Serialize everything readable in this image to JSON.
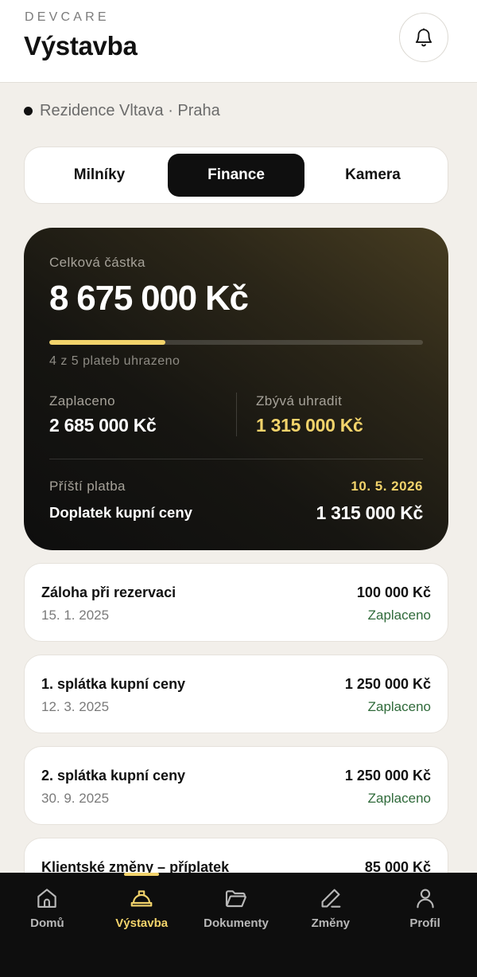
{
  "header": {
    "brand": "DEVCARE",
    "title": "Výstavba",
    "notification_icon": "bell-icon"
  },
  "project": {
    "name": "Rezidence Vltava · Praha"
  },
  "tabs": [
    {
      "label": "Milníky",
      "active": false
    },
    {
      "label": "Finance",
      "active": true
    },
    {
      "label": "Kamera",
      "active": false
    }
  ],
  "summary": {
    "total_label": "Celková částka",
    "total_value": "8 675 000 Kč",
    "progress_fraction": 0.31,
    "progress_text": "4 z 5 plateb uhrazeno",
    "paid_label": "Zaplaceno",
    "paid_value": "2 685 000 Kč",
    "remaining_label": "Zbývá uhradit",
    "remaining_value": "1 315 000 Kč",
    "next_payment_label": "Příští platba",
    "next_payment_date": "10. 5. 2026",
    "next_payment_name": "Doplatek kupní ceny",
    "next_payment_amount": "1 315 000 Kč"
  },
  "payments": [
    {
      "name": "Záloha při rezervaci",
      "date": "15. 1. 2025",
      "amount": "100 000 Kč",
      "status": "Zaplaceno"
    },
    {
      "name": "1. splátka kupní ceny",
      "date": "12. 3. 2025",
      "amount": "1 250 000 Kč",
      "status": "Zaplaceno"
    },
    {
      "name": "2. splátka kupní ceny",
      "date": "30. 9. 2025",
      "amount": "1 250 000 Kč",
      "status": "Zaplaceno"
    },
    {
      "name": "Klientské změny – příplatek",
      "amount": "85 000 Kč"
    }
  ],
  "nav": [
    {
      "label": "Domů",
      "icon": "home-icon",
      "active": false
    },
    {
      "label": "Výstavba",
      "icon": "hard-hat-icon",
      "active": true
    },
    {
      "label": "Dokumenty",
      "icon": "folder-icon",
      "active": false
    },
    {
      "label": "Změny",
      "icon": "pen-icon",
      "active": false
    },
    {
      "label": "Profil",
      "icon": "user-icon",
      "active": false
    }
  ],
  "colors": {
    "accent": "#f2d36b",
    "paid_status": "#2f6a3a",
    "page_bg": "#f2efea",
    "nav_bg": "#0e0e0e"
  }
}
